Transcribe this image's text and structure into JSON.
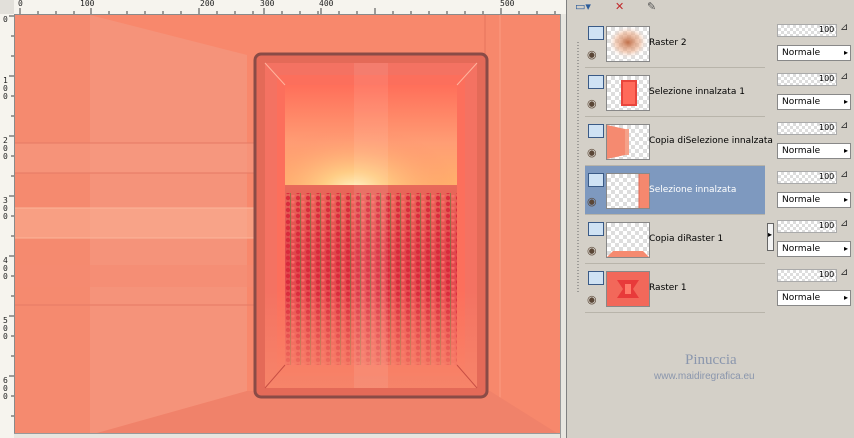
{
  "ruler": {
    "h_ticks": [
      "0",
      "100",
      "200",
      "300",
      "400",
      "500"
    ],
    "v_ticks": [
      "0",
      "1\n0\n0",
      "2\n0\n0",
      "3\n0\n0",
      "4\n0\n0",
      "5\n0\n0",
      "6\n0\n0"
    ]
  },
  "layers": [
    {
      "name": "Raster 2",
      "opacity": "100",
      "blend": "Normale",
      "selected": false,
      "thumb": "glow"
    },
    {
      "name": "Selezione innalzata 1",
      "opacity": "100",
      "blend": "Normale",
      "selected": false,
      "thumb": "red-rect"
    },
    {
      "name": "Copia diSelezione innalzata",
      "opacity": "100",
      "blend": "Normale",
      "selected": false,
      "thumb": "left-strip"
    },
    {
      "name": "Selezione innalzata",
      "opacity": "100",
      "blend": "Normale",
      "selected": true,
      "thumb": "right-strip"
    },
    {
      "name": "Copia diRaster 1",
      "opacity": "100",
      "blend": "Normale",
      "selected": false,
      "thumb": "bottom-strip"
    },
    {
      "name": "Raster 1",
      "opacity": "100",
      "blend": "Normale",
      "selected": false,
      "thumb": "red-full"
    }
  ],
  "watermark": {
    "title": "Pinuccia",
    "url": "www.maidiregrafica.eu"
  },
  "icons": {
    "layer": "layer-icon",
    "eye": "eye-icon",
    "delete": "delete-layer-icon",
    "edit": "edit-icon"
  },
  "colors": {
    "image_bg": "#f7866a",
    "selected_row": "#7e99bf"
  }
}
